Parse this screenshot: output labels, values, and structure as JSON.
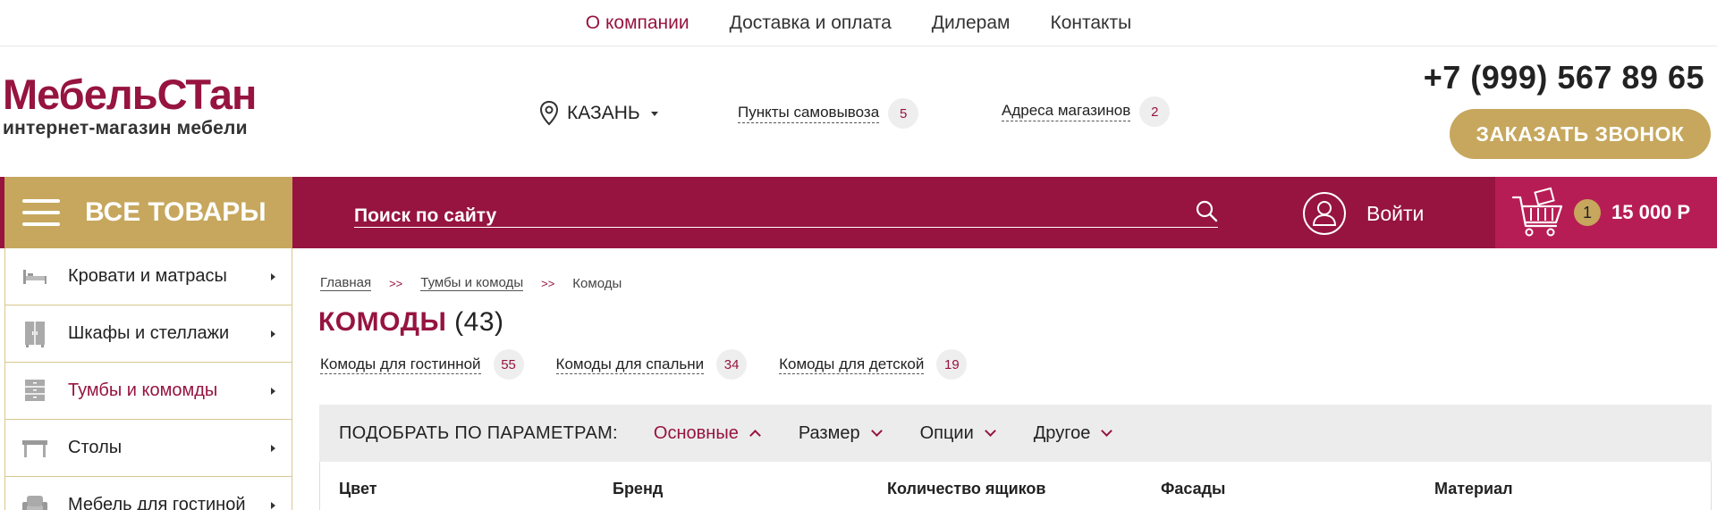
{
  "topnav": {
    "items": [
      "О компании",
      "Доставка и оплата",
      "Дилерам",
      "Контакты"
    ]
  },
  "logo": {
    "main": "МебельСТан",
    "sub": "интернет-магазин мебели"
  },
  "header": {
    "city": "КАЗАНЬ",
    "pickup_label": "Пункты самовывоза",
    "pickup_count": "5",
    "stores_label": "Адреса магазинов",
    "stores_count": "2",
    "phone": "+7 (999) 567 89 65",
    "callback_label": "ЗАКАЗАТЬ ЗВОНОК"
  },
  "bar": {
    "all_goods": "ВСЕ ТОВАРЫ",
    "search_placeholder": "Поиск по сайту",
    "login": "Войти",
    "cart_count": "1",
    "cart_sum": "15 000 Р"
  },
  "sidebar": {
    "items": [
      {
        "label": "Кровати и матрасы",
        "icon": "bed-icon"
      },
      {
        "label": "Шкафы и стеллажи",
        "icon": "wardrobe-icon"
      },
      {
        "label": "Тумбы и комомды",
        "icon": "dresser-icon"
      },
      {
        "label": "Столы",
        "icon": "table-icon"
      },
      {
        "label": "Мебель для гостиной",
        "icon": "armchair-icon"
      }
    ]
  },
  "breadcrumbs": {
    "home": "Главная",
    "parent": "Тумбы и комоды",
    "current": "Комоды",
    "separator": ">>"
  },
  "page": {
    "title": "КОМОДЫ",
    "count": "(43)"
  },
  "subcats": [
    {
      "label": "Комоды для гостинной",
      "count": "55"
    },
    {
      "label": "Комоды для спальни",
      "count": "34"
    },
    {
      "label": "Комоды для детской",
      "count": "19"
    }
  ],
  "filter": {
    "title": "ПОДОБРАТЬ ПО ПАРАМЕТРАМ:",
    "tabs": [
      "Основные",
      "Размер",
      "Опции",
      "Другое"
    ],
    "fields": [
      "Цвет",
      "Бренд",
      "Количество ящиков",
      "Фасады",
      "Материал"
    ]
  },
  "colors": {
    "brand": "#96143f",
    "gold": "#c6a75d",
    "cart_bg": "#b71d55"
  }
}
